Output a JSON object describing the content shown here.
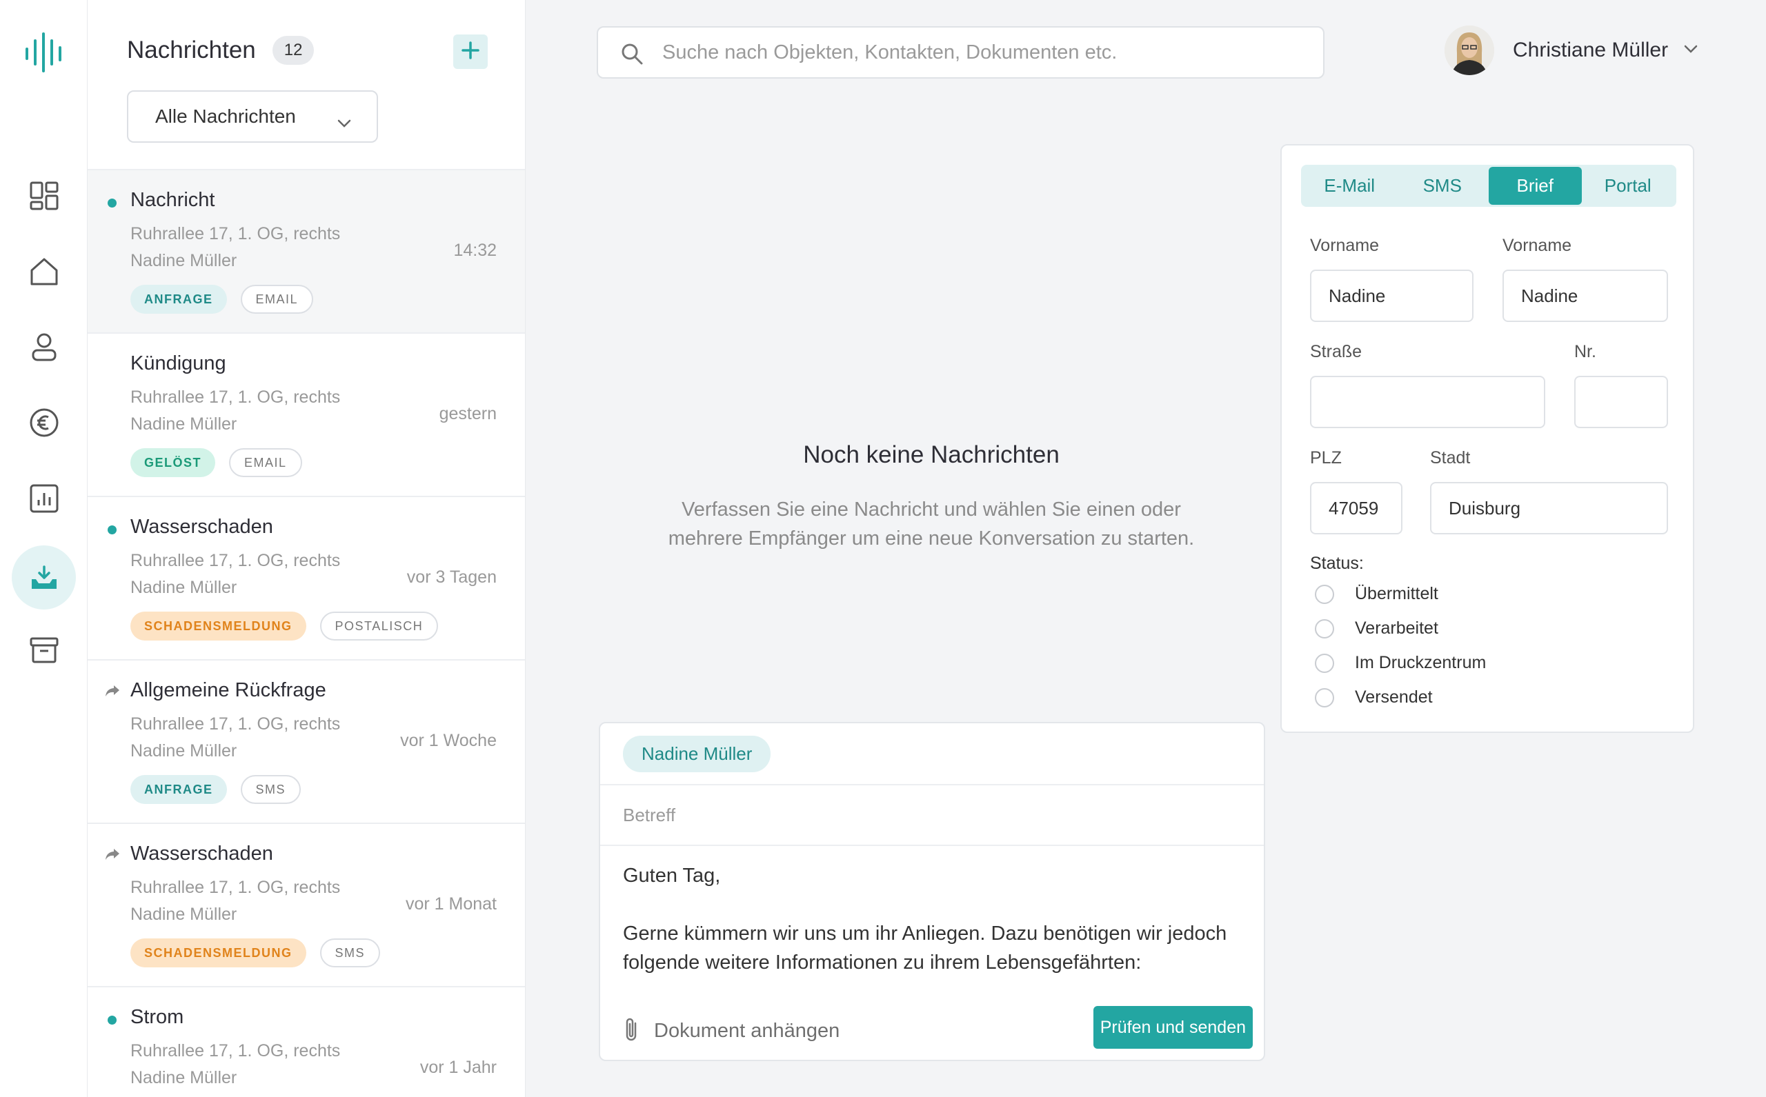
{
  "sidebar_nav": [
    {
      "icon": "dashboard-icon"
    },
    {
      "icon": "home-icon"
    },
    {
      "icon": "user-icon"
    },
    {
      "icon": "euro-icon"
    },
    {
      "icon": "chart-icon"
    },
    {
      "icon": "inbox-icon",
      "active": true
    },
    {
      "icon": "archive-icon"
    }
  ],
  "messages_panel": {
    "title": "Nachrichten",
    "count": "12",
    "filter_label": "Alle Nachrichten"
  },
  "messages": [
    {
      "title": "Nachricht",
      "address": "Ruhrallee 17, 1. OG, rechts",
      "contact": "Nadine Müller",
      "time": "14:32",
      "marker": "unread",
      "tags": [
        {
          "label": "ANFRAGE",
          "type": "anfrage"
        },
        {
          "label": "EMAIL",
          "type": "channel"
        }
      ]
    },
    {
      "title": "Kündigung",
      "address": "Ruhrallee 17, 1. OG, rechts",
      "contact": "Nadine Müller",
      "time": "gestern",
      "marker": "none",
      "tags": [
        {
          "label": "GELÖST",
          "type": "geloest"
        },
        {
          "label": "EMAIL",
          "type": "channel"
        }
      ]
    },
    {
      "title": "Wasserschaden",
      "address": "Ruhrallee 17, 1. OG, rechts",
      "contact": "Nadine Müller",
      "time": "vor 3 Tagen",
      "marker": "unread",
      "tags": [
        {
          "label": "SCHADENSMELDUNG",
          "type": "schaden"
        },
        {
          "label": "POSTALISCH",
          "type": "channel"
        }
      ]
    },
    {
      "title": "Allgemeine Rückfrage",
      "address": "Ruhrallee 17, 1. OG, rechts",
      "contact": "Nadine Müller",
      "time": "vor 1 Woche",
      "marker": "forwarded",
      "tags": [
        {
          "label": "ANFRAGE",
          "type": "anfrage"
        },
        {
          "label": "SMS",
          "type": "channel"
        }
      ]
    },
    {
      "title": "Wasserschaden",
      "address": "Ruhrallee 17, 1. OG, rechts",
      "contact": "Nadine Müller",
      "time": "vor 1 Monat",
      "marker": "forwarded",
      "tags": [
        {
          "label": "SCHADENSMELDUNG",
          "type": "schaden"
        },
        {
          "label": "SMS",
          "type": "channel"
        }
      ]
    },
    {
      "title": "Strom",
      "address": "Ruhrallee 17, 1. OG, rechts",
      "contact": "Nadine Müller",
      "time": "vor 1 Jahr",
      "marker": "unread",
      "tags": []
    }
  ],
  "search": {
    "placeholder": "Suche nach Objekten, Kontakten, Dokumenten etc."
  },
  "user": {
    "name": "Christiane Müller"
  },
  "empty_state": {
    "title": "Noch keine Nachrichten",
    "text": "Verfassen Sie eine Nachricht und wählen Sie einen oder mehrere Empfänger um eine neue Konversation zu starten."
  },
  "composer": {
    "recipient": "Nadine Müller",
    "subject_placeholder": "Betreff",
    "body_line1": "Guten Tag,",
    "body_line2": "Gerne kümmern wir uns um ihr Anliegen. Dazu benötigen wir jedoch folgende weitere Informationen zu ihrem Lebensgefährten:",
    "attach_label": "Dokument anhängen",
    "send_label": "Prüfen und senden"
  },
  "letter_panel": {
    "channels": [
      "E-Mail",
      "SMS",
      "Brief",
      "Portal"
    ],
    "active_channel": "Brief",
    "labels": {
      "firstname_1": "Vorname",
      "firstname_2": "Vorname",
      "street": "Straße",
      "number": "Nr.",
      "zip": "PLZ",
      "city": "Stadt",
      "status": "Status:"
    },
    "values": {
      "firstname_1": "Nadine",
      "firstname_2": "Nadine",
      "street": "",
      "number": "",
      "zip": "47059",
      "city": "Duisburg"
    },
    "status_options": [
      "Übermittelt",
      "Verarbeitet",
      "Im Druckzentrum",
      "Versendet"
    ]
  },
  "colors": {
    "accent": "#23a6a2",
    "accent_light": "#dff1f2",
    "resolved_bg": "#d2f3e8",
    "damage_bg": "#fde3c4",
    "damage_text": "#e0831b"
  }
}
